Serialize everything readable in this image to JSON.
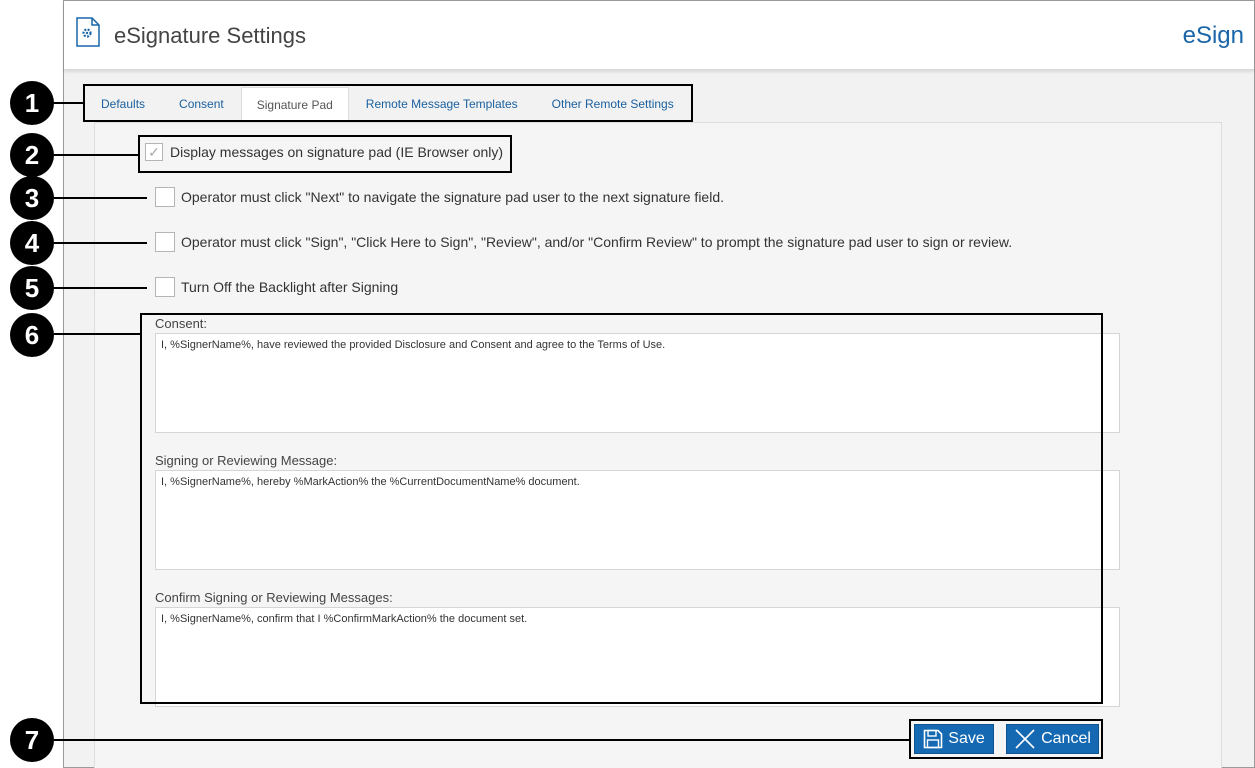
{
  "header": {
    "title": "eSignature Settings",
    "brand": "eSign",
    "icon": "settings-document-icon"
  },
  "tabs": [
    {
      "label": "Defaults",
      "active": false
    },
    {
      "label": "Consent",
      "active": false
    },
    {
      "label": "Signature Pad",
      "active": true
    },
    {
      "label": "Remote Message Templates",
      "active": false
    },
    {
      "label": "Other Remote Settings",
      "active": false
    }
  ],
  "options": [
    {
      "label": "Display messages on signature pad (IE Browser only)",
      "checked": true,
      "disabled": true
    },
    {
      "label": "Operator must click \"Next\" to navigate the signature pad user to the next signature field.",
      "checked": false
    },
    {
      "label": "Operator must click \"Sign\", \"Click Here to Sign\", \"Review\", and/or \"Confirm Review\" to prompt the signature pad user to sign or review.",
      "checked": false
    },
    {
      "label": "Turn Off the Backlight after Signing",
      "checked": false
    }
  ],
  "messages": [
    {
      "label": "Consent:",
      "value": "I, %SignerName%, have reviewed the provided Disclosure and Consent and agree to the Terms of Use."
    },
    {
      "label": "Signing or Reviewing Message:",
      "value": "I, %SignerName%, hereby %MarkAction% the %CurrentDocumentName% document."
    },
    {
      "label": "Confirm Signing or Reviewing Messages:",
      "value": "I, %SignerName%, confirm that I %ConfirmMarkAction% the document set."
    }
  ],
  "actions": {
    "save_label": "Save",
    "save_icon": "floppy-disk-icon",
    "cancel_label": "Cancel",
    "cancel_icon": "close-x-icon"
  },
  "callouts": [
    "1",
    "2",
    "3",
    "4",
    "5",
    "6",
    "7"
  ],
  "colors": {
    "accent": "#1a66a8",
    "button": "#1569b2",
    "callout": "#000000"
  }
}
